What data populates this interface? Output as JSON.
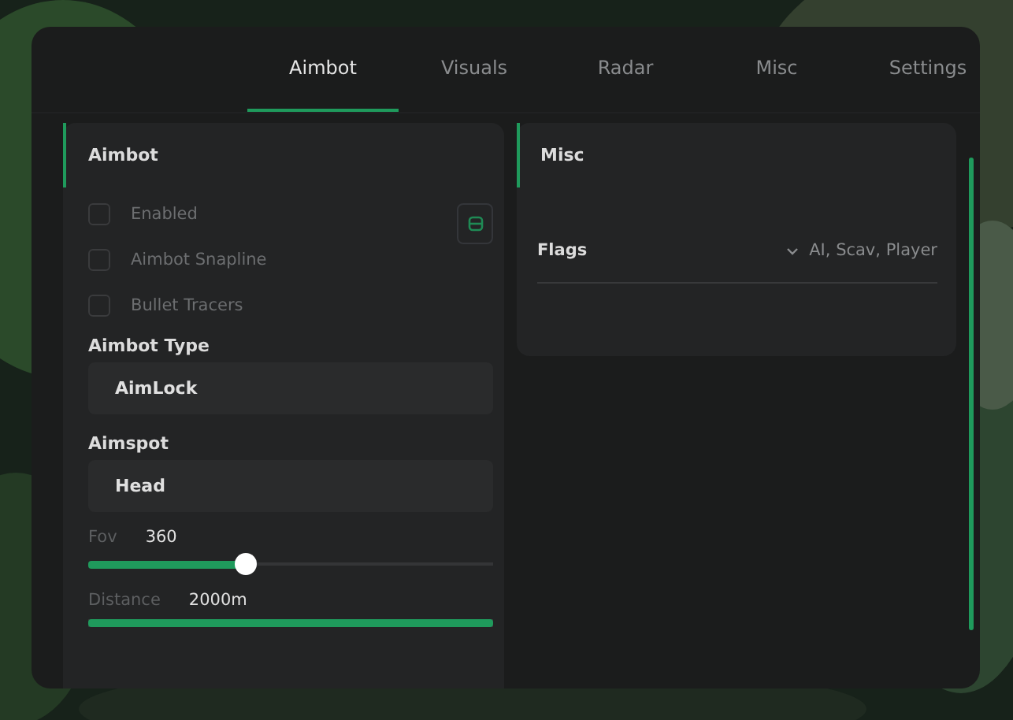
{
  "tabs": [
    {
      "label": "Aimbot",
      "selected": true
    },
    {
      "label": "Visuals",
      "selected": false
    },
    {
      "label": "Radar",
      "selected": false
    },
    {
      "label": "Misc",
      "selected": false
    },
    {
      "label": "Settings",
      "selected": false
    }
  ],
  "left_panel": {
    "title": "Aimbot",
    "checkboxes": [
      {
        "label": "Enabled",
        "checked": false
      },
      {
        "label": "Aimbot Snapline",
        "checked": false
      },
      {
        "label": "Bullet Tracers",
        "checked": false
      }
    ],
    "dropdowns": [
      {
        "label": "Aimbot Type",
        "value": "AimLock"
      },
      {
        "label": "Aimspot",
        "value": "Head"
      }
    ],
    "sliders": [
      {
        "label": "Fov",
        "reading": "360",
        "level": 0.39,
        "kind": "thumb"
      },
      {
        "label": "Distance",
        "reading": "2000m",
        "level": 1,
        "kind": "bar"
      }
    ]
  },
  "right_panel": {
    "title": "Misc",
    "flags": {
      "label": "Flags",
      "value": "AI, Scav, Player"
    }
  }
}
